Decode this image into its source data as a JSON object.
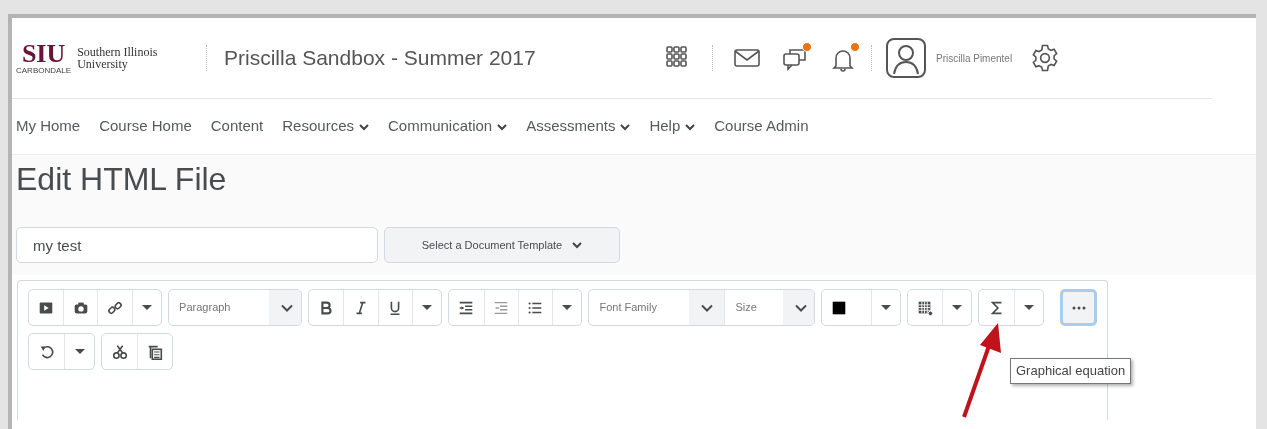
{
  "logo": {
    "mark": "SIU",
    "name": "Southern Illinois University",
    "sub": "CARBONDALE"
  },
  "course_title": "Priscilla Sandbox - Summer 2017",
  "header_icons": [
    {
      "kind": "grid",
      "notification": false
    },
    {
      "kind": "mail",
      "notification": false
    },
    {
      "kind": "chat",
      "notification": true
    },
    {
      "kind": "bell",
      "notification": true
    }
  ],
  "user": {
    "name": "Priscilla Pimentel"
  },
  "nav": [
    {
      "label": "My Home",
      "dropdown": false
    },
    {
      "label": "Course Home",
      "dropdown": false
    },
    {
      "label": "Content",
      "dropdown": false
    },
    {
      "label": "Resources",
      "dropdown": true
    },
    {
      "label": "Communication",
      "dropdown": true
    },
    {
      "label": "Assessments",
      "dropdown": true
    },
    {
      "label": "Help",
      "dropdown": true
    },
    {
      "label": "Course Admin",
      "dropdown": false
    }
  ],
  "page_title": "Edit HTML File",
  "title_field": {
    "value": "my test"
  },
  "template_button": {
    "label": "Select a Document Template"
  },
  "toolbar_rows": [
    [
      [
        {
          "kind": "video"
        },
        {
          "kind": "camera"
        },
        {
          "kind": "link"
        },
        {
          "kind": "caret"
        }
      ],
      [
        {
          "kind": "select",
          "label": "Paragraph"
        }
      ],
      [
        {
          "kind": "bold"
        },
        {
          "kind": "italic"
        },
        {
          "kind": "underline"
        },
        {
          "kind": "caret"
        }
      ],
      [
        {
          "kind": "indent"
        },
        {
          "kind": "outdent"
        },
        {
          "kind": "list"
        },
        {
          "kind": "caret"
        }
      ],
      [
        {
          "kind": "select",
          "label": "Font Family"
        },
        {
          "kind": "select",
          "label": "Size"
        }
      ],
      [
        {
          "kind": "color"
        },
        {
          "kind": "caret"
        }
      ],
      [
        {
          "kind": "table"
        },
        {
          "kind": "caret"
        }
      ],
      [
        {
          "kind": "sigma"
        },
        {
          "kind": "caret"
        }
      ],
      [
        {
          "kind": "more",
          "focused": true
        }
      ]
    ],
    [
      [
        {
          "kind": "undo"
        },
        {
          "kind": "caret"
        }
      ],
      [
        {
          "kind": "cut"
        },
        {
          "kind": "paste"
        }
      ]
    ]
  ],
  "tooltip": {
    "text": "Graphical equation"
  }
}
